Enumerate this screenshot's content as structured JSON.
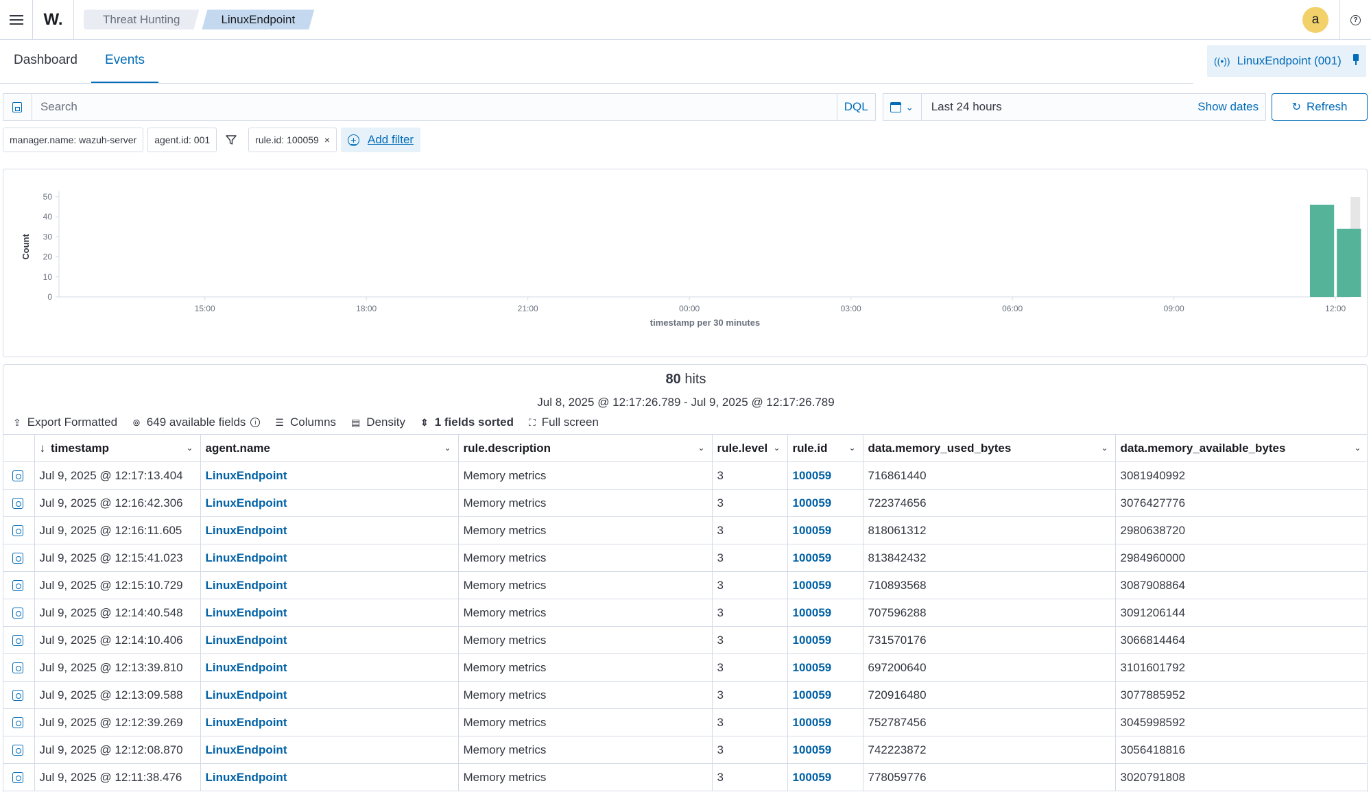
{
  "app": {
    "logo": "W.",
    "breadcrumbs": [
      "Threat Hunting",
      "LinuxEndpoint"
    ],
    "avatar_initial": "a",
    "help_glyph": "?",
    "icons": [
      "menu-icon",
      "help-icon",
      "signal-icon",
      "pin-icon",
      "save-query-icon",
      "calendar-icon",
      "refresh-icon",
      "filter-icon",
      "plus-circle-icon",
      "export-icon",
      "fields-icon",
      "columns-icon",
      "density-icon",
      "sort-icon",
      "fullscreen-icon",
      "inspect-document-icon",
      "chevron-down-icon"
    ]
  },
  "tabs": [
    {
      "label": "Dashboard",
      "active": false
    },
    {
      "label": "Events",
      "active": true
    }
  ],
  "agent_pill": {
    "label": "LinuxEndpoint (001)"
  },
  "search": {
    "placeholder": "Search",
    "value": "",
    "language": "DQL",
    "time_range": "Last 24 hours",
    "show_dates": "Show dates",
    "refresh": "Refresh"
  },
  "filters": {
    "pinned": [
      "manager.name: wazuh-server",
      "agent.id: 001"
    ],
    "active": [
      "rule.id: 100059"
    ],
    "add_filter": "Add filter",
    "remove_glyph": "×"
  },
  "colors": {
    "accent": "#006bb8",
    "bar": "#54b399",
    "bar_highlight": "#e6e6e6"
  },
  "chart_data": {
    "type": "bar",
    "title": "",
    "xlabel": "timestamp per 30 minutes",
    "ylabel": "Count",
    "ylim": [
      0,
      50
    ],
    "yticks": [
      0,
      10,
      20,
      30,
      40,
      50
    ],
    "xticks": [
      "15:00",
      "18:00",
      "21:00",
      "00:00",
      "03:00",
      "06:00",
      "09:00",
      "12:00"
    ],
    "x_start": "Jul 8, 2025 @ 12:17:26.789",
    "x_end": "Jul 9, 2025 @ 12:17:26.789",
    "bars": [
      {
        "time": "11:30",
        "value": 46
      },
      {
        "time": "12:00",
        "value": 34
      }
    ],
    "grid": false,
    "legend": "none"
  },
  "hits": {
    "count": "80",
    "label": "hits",
    "range": "Jul 8, 2025 @ 12:17:26.789 - Jul 9, 2025 @ 12:17:26.789"
  },
  "toolbar": {
    "export": "Export Formatted",
    "fields": "649 available fields",
    "columns": "Columns",
    "density": "Density",
    "sorted": "1 fields sorted",
    "fullscreen": "Full screen"
  },
  "table": {
    "columns": [
      "timestamp",
      "agent.name",
      "rule.description",
      "rule.level",
      "rule.id",
      "data.memory_used_bytes",
      "data.memory_available_bytes"
    ],
    "rows": [
      [
        "Jul 9, 2025 @ 12:17:13.404",
        "LinuxEndpoint",
        "Memory metrics",
        "3",
        "100059",
        "716861440",
        "3081940992"
      ],
      [
        "Jul 9, 2025 @ 12:16:42.306",
        "LinuxEndpoint",
        "Memory metrics",
        "3",
        "100059",
        "722374656",
        "3076427776"
      ],
      [
        "Jul 9, 2025 @ 12:16:11.605",
        "LinuxEndpoint",
        "Memory metrics",
        "3",
        "100059",
        "818061312",
        "2980638720"
      ],
      [
        "Jul 9, 2025 @ 12:15:41.023",
        "LinuxEndpoint",
        "Memory metrics",
        "3",
        "100059",
        "813842432",
        "2984960000"
      ],
      [
        "Jul 9, 2025 @ 12:15:10.729",
        "LinuxEndpoint",
        "Memory metrics",
        "3",
        "100059",
        "710893568",
        "3087908864"
      ],
      [
        "Jul 9, 2025 @ 12:14:40.548",
        "LinuxEndpoint",
        "Memory metrics",
        "3",
        "100059",
        "707596288",
        "3091206144"
      ],
      [
        "Jul 9, 2025 @ 12:14:10.406",
        "LinuxEndpoint",
        "Memory metrics",
        "3",
        "100059",
        "731570176",
        "3066814464"
      ],
      [
        "Jul 9, 2025 @ 12:13:39.810",
        "LinuxEndpoint",
        "Memory metrics",
        "3",
        "100059",
        "697200640",
        "3101601792"
      ],
      [
        "Jul 9, 2025 @ 12:13:09.588",
        "LinuxEndpoint",
        "Memory metrics",
        "3",
        "100059",
        "720916480",
        "3077885952"
      ],
      [
        "Jul 9, 2025 @ 12:12:39.269",
        "LinuxEndpoint",
        "Memory metrics",
        "3",
        "100059",
        "752787456",
        "3045998592"
      ],
      [
        "Jul 9, 2025 @ 12:12:08.870",
        "LinuxEndpoint",
        "Memory metrics",
        "3",
        "100059",
        "742223872",
        "3056418816"
      ],
      [
        "Jul 9, 2025 @ 12:11:38.476",
        "LinuxEndpoint",
        "Memory metrics",
        "3",
        "100059",
        "778059776",
        "3020791808"
      ]
    ]
  }
}
